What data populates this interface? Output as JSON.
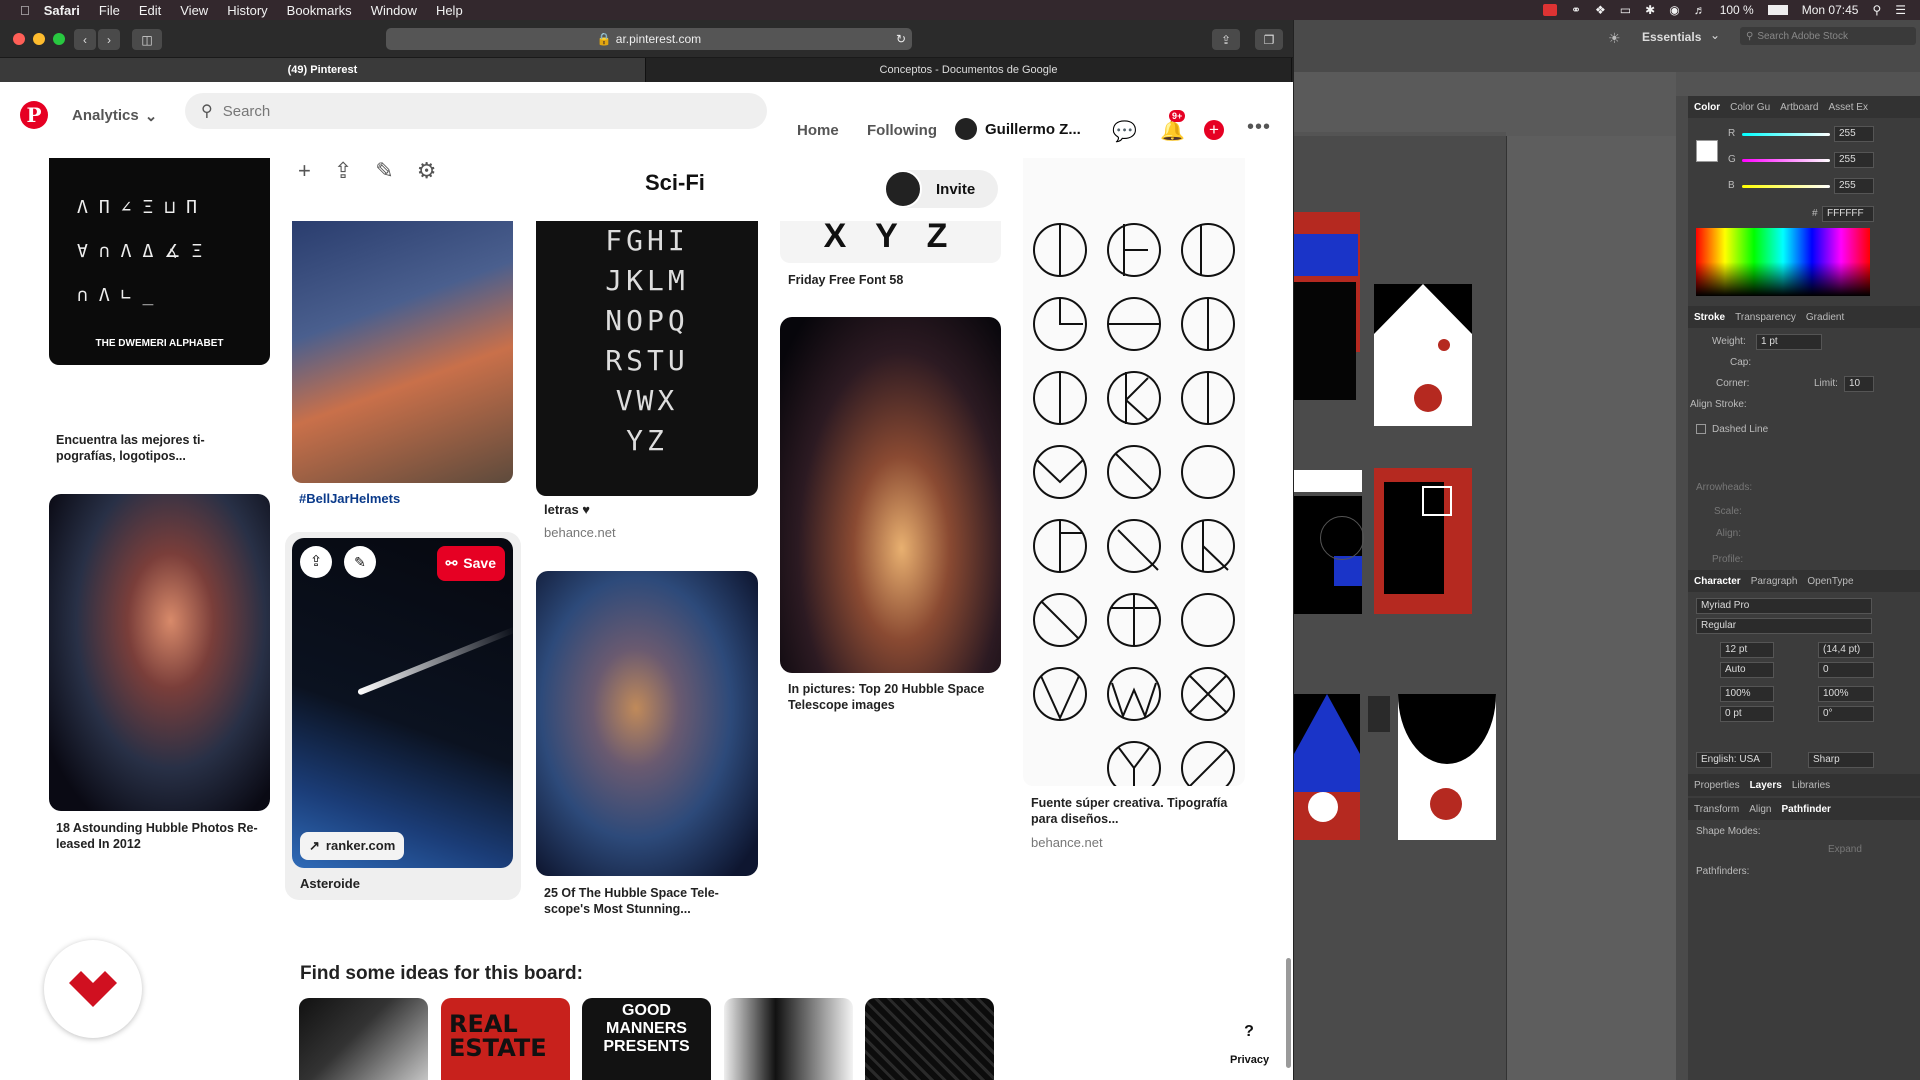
{
  "menubar": {
    "app": "Safari",
    "items": [
      "File",
      "Edit",
      "View",
      "History",
      "Bookmarks",
      "Window",
      "Help"
    ],
    "battery": "100 %",
    "clock": "Mon 07:45"
  },
  "browser": {
    "url": "ar.pinterest.com",
    "tabs": [
      "(49) Pinterest",
      "Conceptos - Documentos de Google"
    ]
  },
  "pinterest": {
    "logo": "P",
    "analytics_label": "Analytics",
    "search_placeholder": "Search",
    "nav": {
      "home": "Home",
      "following": "Following",
      "user": "Guillermo Z..."
    },
    "notif_badge": "9+",
    "board_title": "Sci-Fi",
    "invite_label": "Invite",
    "pins": [
      {
        "caption": "Encuentra las mejores ti-\npografías, logotipos...",
        "card_title": "THE DWEMERI ALPHABET"
      },
      {
        "caption": "18 Astounding Hubble Photos Re-\nleased In 2012"
      },
      {
        "caption": "#BellJarHelmets"
      },
      {
        "caption": "Asteroide",
        "source_badge": "ranker.com",
        "save_label": "Save"
      },
      {
        "caption": "letras ♥",
        "source": "behance.net",
        "letters": [
          "FGHI",
          "JKLM",
          "NOPQ",
          "RSTU",
          "VWX",
          "YZ"
        ]
      },
      {
        "caption": "25 Of The Hubble Space Tele-\nscope's Most Stunning..."
      },
      {
        "caption": "Friday Free Font 58",
        "top_letters": "X Y Z"
      },
      {
        "caption": "In pictures: Top 20 Hubble Space\nTelescope images"
      },
      {
        "caption": "Fuente súper creativa. Tipografía\npara diseños...",
        "source": "behance.net"
      }
    ],
    "ideas_title": "Find some ideas for this board:",
    "ideas": [
      "",
      "REAL ESTATE",
      "GOOD MANNERS PRESENTS",
      "",
      ""
    ],
    "help": "?",
    "privacy": "Privacy"
  },
  "illustrator": {
    "workspace": "Essentials",
    "search_placeholder": "Search Adobe Stock",
    "color_tabs": [
      "Color",
      "Color Gu",
      "Artboard",
      "Asset Ex"
    ],
    "rgb": {
      "r": "255",
      "g": "255",
      "b": "255",
      "hex": "FFFFFF"
    },
    "stroke_tabs": [
      "Stroke",
      "Transparency",
      "Gradient"
    ],
    "stroke": {
      "weight_label": "Weight:",
      "weight": "1 pt",
      "cap_label": "Cap:",
      "corner_label": "Corner:",
      "limit_label": "Limit:",
      "limit": "10",
      "align_label": "Align Stroke:",
      "dashed": "Dashed Line",
      "arrowheads": "Arrowheads:",
      "scale": "Scale:",
      "align": "Align:",
      "profile": "Profile:"
    },
    "character_tabs": [
      "Character",
      "Paragraph",
      "OpenType"
    ],
    "character": {
      "font": "Myriad Pro",
      "style": "Regular",
      "size": "12 pt",
      "leading": "(14,4 pt)",
      "kerning": "Auto",
      "tracking": "0",
      "vscale": "100%",
      "hscale": "100%",
      "baseline": "0 pt",
      "rotation": "0°",
      "language": "English: USA",
      "aa": "Sharp"
    },
    "bottom_tabs": [
      "Properties",
      "Layers",
      "Libraries"
    ],
    "bottom_tabs2": [
      "Transform",
      "Align",
      "Pathfinder"
    ],
    "shape_modes": "Shape Modes:",
    "expand": "Expand",
    "pathfinders": "Pathfinders:"
  }
}
